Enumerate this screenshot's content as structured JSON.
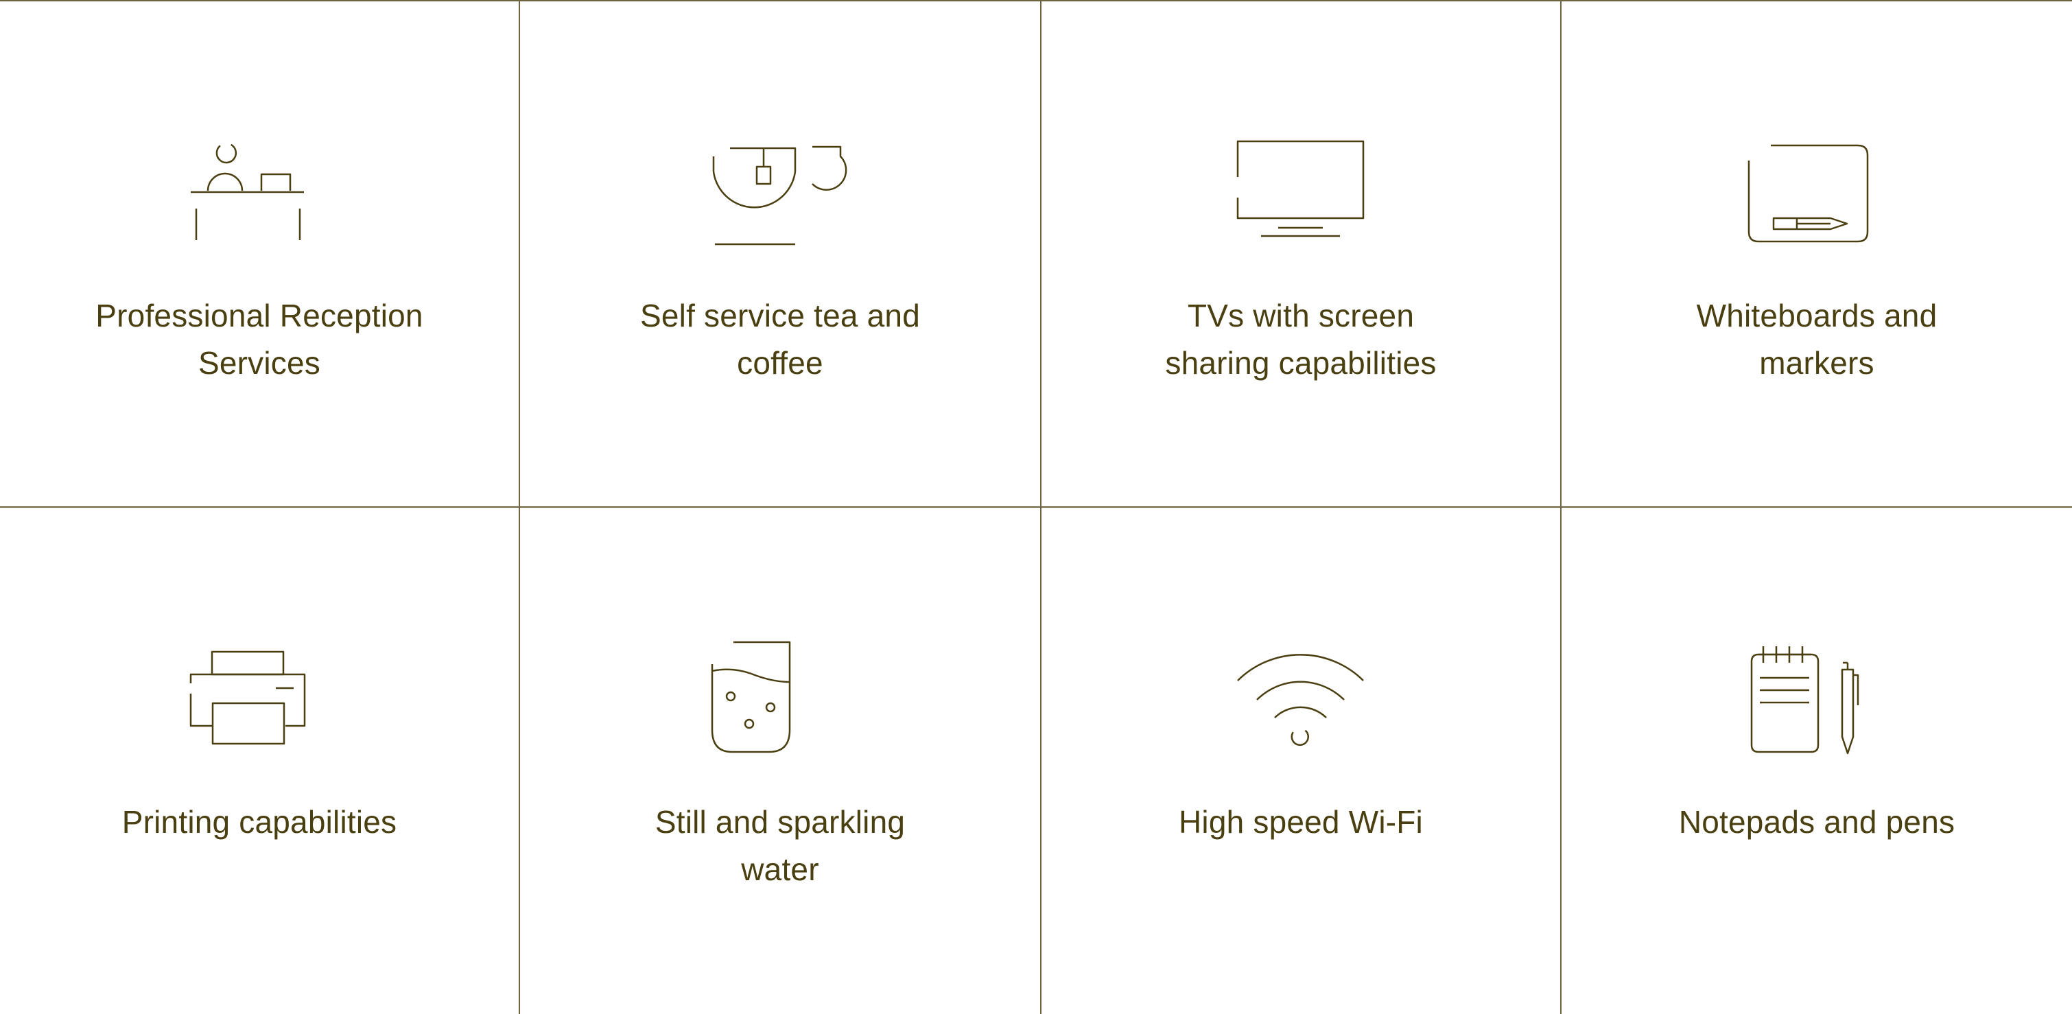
{
  "theme": {
    "text_color": "#4a3f10",
    "line_color": "#6d6540",
    "background": "#ffffff"
  },
  "amenities": [
    {
      "label": "Professional Reception Services",
      "icon": "reception-desk-icon"
    },
    {
      "label": "Self service tea and coffee",
      "icon": "tea-cup-icon"
    },
    {
      "label": "TVs with screen sharing capabilities",
      "icon": "tv-monitor-icon"
    },
    {
      "label": "Whiteboards and markers",
      "icon": "whiteboard-marker-icon"
    },
    {
      "label": "Printing capabilities",
      "icon": "printer-icon"
    },
    {
      "label": "Still and sparkling water",
      "icon": "water-glass-icon"
    },
    {
      "label": "High speed Wi-Fi",
      "icon": "wifi-icon"
    },
    {
      "label": "Notepads and pens",
      "icon": "notepad-pen-icon"
    }
  ]
}
